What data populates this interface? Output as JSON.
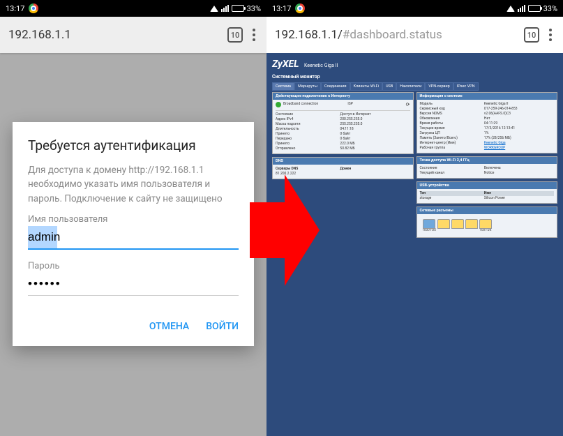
{
  "status": {
    "time": "13:17",
    "battery": "33%"
  },
  "left": {
    "url": "192.168.1.1",
    "tab_count": "10",
    "dialog": {
      "title": "Требуется аутентификация",
      "message": "Для доступа к домену http://192.168.1.1 необходимо указать имя пользователя и пароль. Подключение к сайту не защищено",
      "username_label": "Имя пользователя",
      "username_value": "admin",
      "password_label": "Пароль",
      "password_value": "••••••",
      "cancel": "ОТМЕНА",
      "login": "ВОЙТИ"
    }
  },
  "right": {
    "url": "192.168.1.1/",
    "url_fragment": "#dashboard.status",
    "tab_count": "10",
    "router": {
      "brand": "ZyXEL",
      "model": "Keenetic Giga II",
      "monitor_title": "Системный монитор",
      "tabs": [
        "Система",
        "Маршруты",
        "Соединения",
        "Клиенты Wi-Fi",
        "USB",
        "Накопители",
        "VPN-сервер",
        "IPsec VPN"
      ],
      "panel_conn": {
        "title": "Действующее подключение к Интернету",
        "status_row": {
          "k": "Broadband connection",
          "v": "ISP"
        },
        "rows": [
          {
            "k": "Состояние",
            "v": "Доступ в Интернет"
          },
          {
            "k": "Адрес IPv4",
            "v": "200.255.255.0"
          },
          {
            "k": "Маска подсети",
            "v": "255.255.255.0"
          },
          {
            "k": "Длительность",
            "v": "04:11:18"
          },
          {
            "k": "Принято",
            "v": "0 байт"
          },
          {
            "k": "Передано",
            "v": "0 байт"
          },
          {
            "k": "Принято",
            "v": "222.0 МБ"
          },
          {
            "k": "Отправлено",
            "v": "50.82 МБ"
          }
        ]
      },
      "panel_dns": {
        "title": "DNS",
        "header_row": {
          "k": "Серверы DNS",
          "v": "Домен"
        },
        "rows": [
          {
            "k": "81.200.2.222",
            "v": ""
          }
        ]
      },
      "panel_sys": {
        "title": "Информация о системе",
        "rows": [
          {
            "k": "Модель",
            "v": "Keenetic Giga II"
          },
          {
            "k": "Сервисный код",
            "v": "017-259-246-014-853"
          },
          {
            "k": "Версия NDMS",
            "v": "v2.06(AAFS.0)C3"
          },
          {
            "k": "Обновления",
            "v": "Нет"
          },
          {
            "k": "Время работы",
            "v": "04:11:29"
          },
          {
            "k": "Текущее время",
            "v": "17/3/2016 12:13:41"
          },
          {
            "k": "Загрузка ЦП",
            "v": "1%"
          },
          {
            "k": "Память (Занято/Всего)",
            "v": "17% (28/256 МБ)"
          },
          {
            "k": "Интернет-центр (Имя)",
            "v": "Keenetic Giga"
          },
          {
            "k": "Рабочая группа",
            "v": "WORKGROUP"
          }
        ]
      },
      "panel_wifi": {
        "title": "Точка доступа Wi-Fi 2,4 ГГц",
        "rows": [
          {
            "k": "Состояние",
            "v": "Включена"
          },
          {
            "k": "Текущий канал",
            "v": "Notice"
          }
        ]
      },
      "panel_usb": {
        "title": "USB-устройства",
        "header_row": {
          "k": "Тип",
          "v": "Имя"
        },
        "rows": [
          {
            "k": "storage",
            "v": "Silicon Power"
          }
        ]
      },
      "panel_ports": {
        "title": "Сетевые разъемы",
        "labels": [
          "1000 FDX",
          "100 FDX"
        ]
      }
    }
  }
}
